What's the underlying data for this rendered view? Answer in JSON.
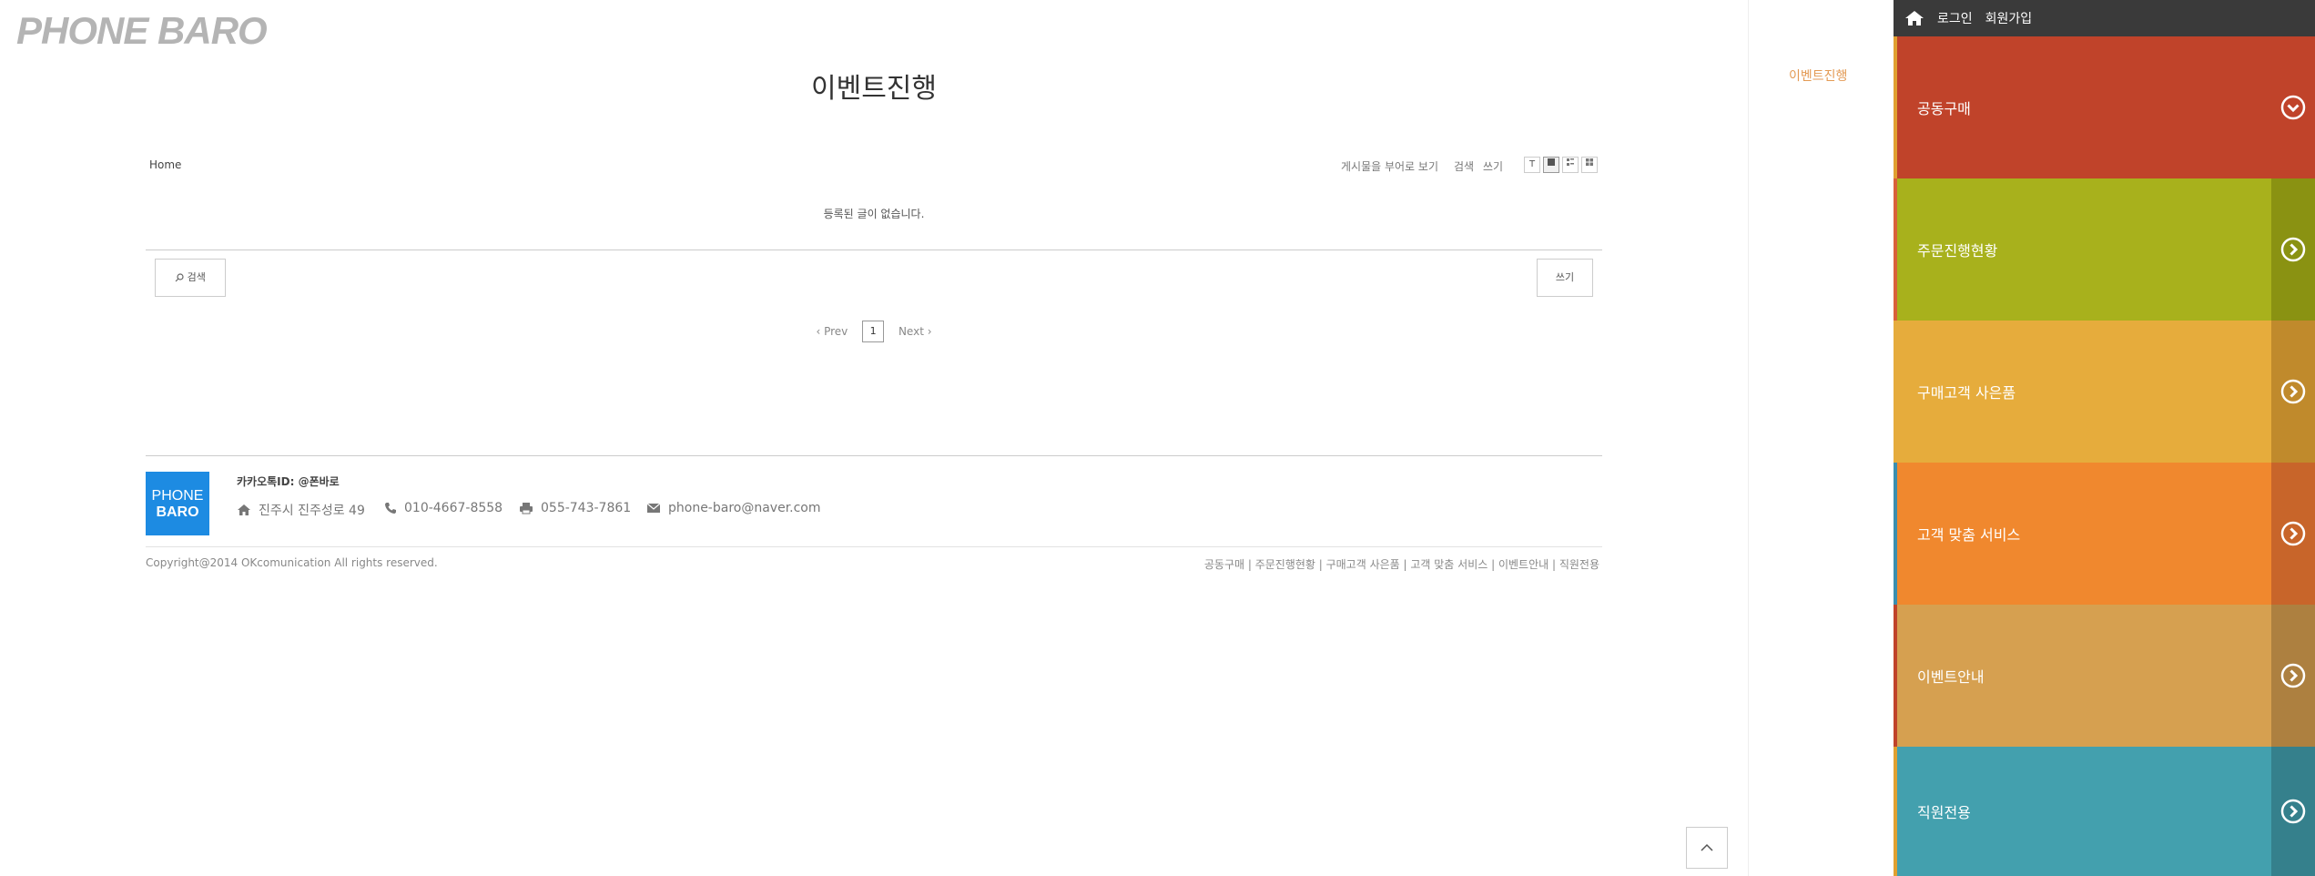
{
  "logo": "PHONE BARO",
  "page_title": "이벤트진행",
  "breadcrumb": "Home",
  "toolbar": {
    "view_all": "게시물을 부어로 보기",
    "search": "검색",
    "write": "쓰기",
    "view_text": "T"
  },
  "empty_message": "등록된 글이 없습니다.",
  "search_button": "검색",
  "write_button": "쓰기",
  "pager": {
    "prev": "‹ Prev",
    "page": "1",
    "next": "Next ›"
  },
  "footer": {
    "logo_line1": "PHONE",
    "logo_line2": "BARO",
    "kakao": "카카오톡ID: @폰바로",
    "address": "진주시 진주성로 49",
    "phone": "010-4667-8558",
    "fax": "055-743-7861",
    "email": "phone-baro@naver.com",
    "copyright": "Copyright@2014 OKcomunication All rights reserved.",
    "links": "공동구매 | 주문진행현황 | 구매고객 사은품 | 고객 맞춤 서비스 | 이벤트안내 | 직원전용"
  },
  "side_tag": "이벤트진행",
  "right_panel": {
    "login": "로그인",
    "signup": "회원가입",
    "menu": [
      {
        "label": "공동구매",
        "bg": "#c0432a",
        "strip": "#c0432a",
        "edge": "#e0a030"
      },
      {
        "label": "주문진행현황",
        "bg": "#a8b11c",
        "strip": "#8a9212",
        "edge": "#d9603a"
      },
      {
        "label": "구매고객 사은품",
        "bg": "#e6ac3c",
        "strip": "#c08a2c",
        "edge": "#e6ac3c"
      },
      {
        "label": "고객 맞춤 서비스",
        "bg": "#f0882e",
        "strip": "#c8652a",
        "edge": "#3a8fb0"
      },
      {
        "label": "이벤트안내",
        "bg": "#d6a050",
        "strip": "#ad8040",
        "edge": "#c0432a"
      },
      {
        "label": "직원전용",
        "bg": "#43a0ae",
        "strip": "#35808c",
        "edge": "#e0a030"
      }
    ]
  }
}
